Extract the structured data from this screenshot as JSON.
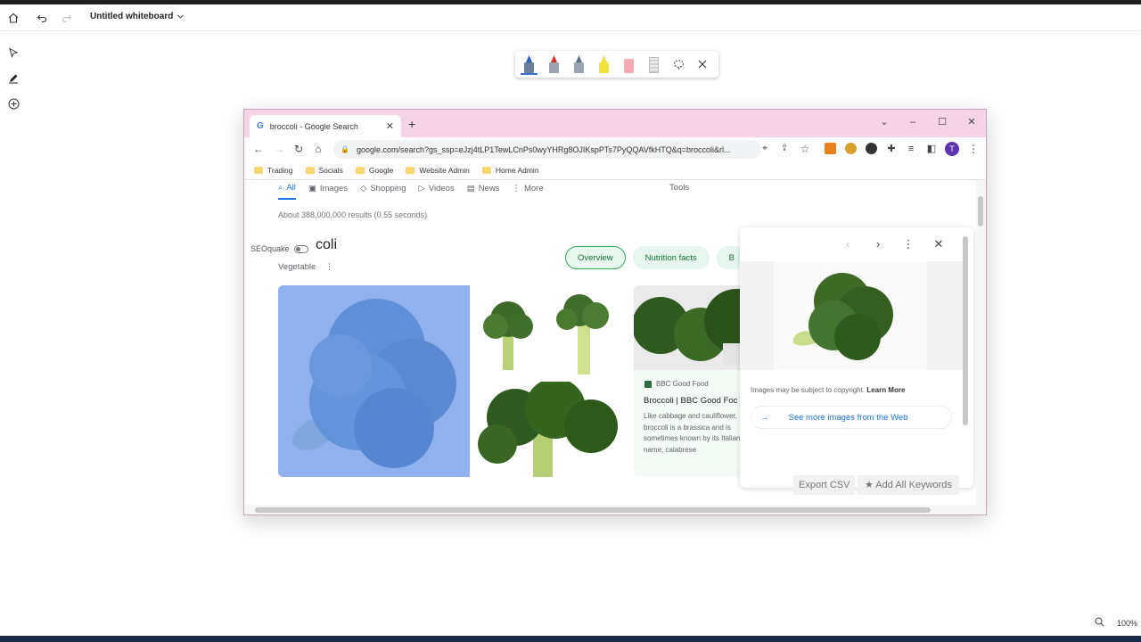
{
  "app": {
    "title": "Untitled whiteboard",
    "zoom_label": "100%"
  },
  "header_icons": [
    "home-icon",
    "undo-icon",
    "redo-icon",
    "chevron-down-icon"
  ],
  "rail_tools": [
    "select-tool-icon",
    "pen-tool-icon",
    "add-icon"
  ],
  "pen_toolbar": {
    "pens": [
      {
        "name": "blue-pen",
        "color": "#2f5fb3"
      },
      {
        "name": "red-pen",
        "color": "#d93025"
      },
      {
        "name": "gray-pen",
        "color": "#5b6f8f"
      },
      {
        "name": "highlighter",
        "color": "#f2e13a"
      },
      {
        "name": "eraser",
        "color": "#f4a9b3"
      },
      {
        "name": "ruler",
        "color": "#bdbdbd"
      }
    ]
  },
  "browser": {
    "tab_title": "broccoli - Google Search",
    "url": "google.com/search?gs_ssp=eJzj4tLP1TewLCnPs0wyYHRg8OJIKspPTs7PyQQAVfkHTQ&q=broccoli&rl...",
    "bookmarks": [
      "Trading",
      "Socials",
      "Google",
      "Website Admin",
      "Home Admin"
    ],
    "profile_initial": "T",
    "accent": "#5e35b1"
  },
  "search": {
    "tabs": [
      "All",
      "Images",
      "Shopping",
      "Videos",
      "News",
      "More"
    ],
    "tools_label": "Tools",
    "result_stats": "About 388,000,000 results (0.55 seconds)",
    "seoquake_label": "SEOquake",
    "kp_title": "coli",
    "kp_subtitle": "Vegetable",
    "chips": [
      "Overview",
      "Nutrition facts",
      "B"
    ],
    "card": {
      "source": "BBC Good Food",
      "title": "Broccoli | BBC Good Foc",
      "snippet": "Like cabbage and cauliflower, broccoli is a brassica and is sometimes known by its Italian name, calabrese"
    }
  },
  "preview_panel": {
    "copyright_text": "Images may be subject to copyright.",
    "learn_more": "Learn More",
    "see_more": "See more images from the Web",
    "export_csv": "Export CSV",
    "add_keywords": "★ Add All Keywords"
  }
}
